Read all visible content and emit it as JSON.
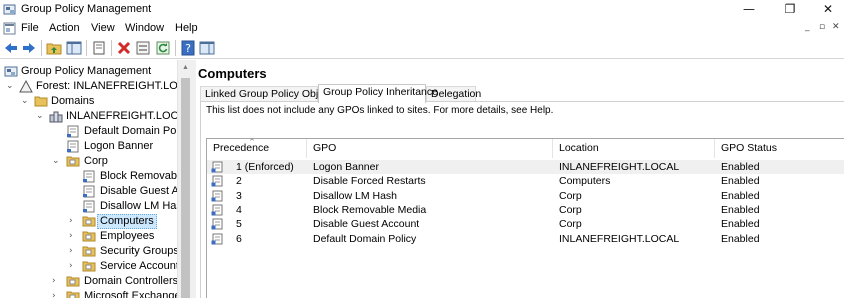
{
  "window": {
    "title": "Group Policy Management",
    "minimize_glyph": "—",
    "restore_glyph": "❐",
    "close_glyph": "✕"
  },
  "menu": {
    "items": [
      "File",
      "Action",
      "View",
      "Window",
      "Help"
    ],
    "mdi": {
      "minimize": "_",
      "restore": "▫",
      "close": "✕"
    }
  },
  "toolbar": {
    "buttons": [
      "back-arrow-icon",
      "forward-arrow-icon",
      "up-folder-icon",
      "show-hide-tree-icon",
      "copy-icon",
      "delete-icon",
      "properties-icon",
      "refresh-icon",
      "help-icon",
      "console-pane-icon"
    ]
  },
  "tree": {
    "nodes": [
      {
        "label": "Group Policy Management",
        "expander": "",
        "icon": "gpm-icon"
      },
      {
        "label": "Forest: INLANEFREIGHT.LOCAL",
        "expander": "⌄",
        "icon": "forest-icon"
      },
      {
        "label": "Domains",
        "expander": "⌄",
        "icon": "folder-icon"
      },
      {
        "label": "INLANEFREIGHT.LOCAL",
        "expander": "⌄",
        "icon": "domain-icon"
      },
      {
        "label": "Default Domain Polic",
        "expander": "",
        "icon": "gpo-link-icon"
      },
      {
        "label": "Logon Banner",
        "expander": "",
        "icon": "gpo-link-icon"
      },
      {
        "label": "Corp",
        "expander": "⌄",
        "icon": "ou-folder-icon"
      },
      {
        "label": "Block Removable",
        "expander": "",
        "icon": "gpo-link-icon"
      },
      {
        "label": "Disable Guest Acc",
        "expander": "",
        "icon": "gpo-link-icon"
      },
      {
        "label": "Disallow LM Hash",
        "expander": "",
        "icon": "gpo-link-icon"
      },
      {
        "label": "Computers",
        "expander": "›",
        "icon": "ou-folder-icon"
      },
      {
        "label": "Employees",
        "expander": "›",
        "icon": "ou-folder-icon"
      },
      {
        "label": "Security Groups",
        "expander": "›",
        "icon": "ou-folder-icon"
      },
      {
        "label": "Service Accounts",
        "expander": "›",
        "icon": "ou-folder-icon"
      },
      {
        "label": "Domain Controllers",
        "expander": "›",
        "icon": "ou-folder-icon"
      },
      {
        "label": "Microsoft Exchange S",
        "expander": "›",
        "icon": "ou-folder-icon"
      }
    ],
    "selected": "Computers"
  },
  "main": {
    "heading": "Computers",
    "tabs": [
      "Linked Group Policy Objects",
      "Group Policy Inheritance",
      "Delegation"
    ],
    "active_tab": "Group Policy Inheritance",
    "note": "This list does not include any GPOs linked to sites. For more details, see Help.",
    "columns": [
      "Precedence",
      "GPO",
      "Location",
      "GPO Status"
    ],
    "sort_glyph": "^",
    "rows": [
      {
        "precedence": "1  (Enforced)",
        "gpo": "Logon Banner",
        "location": "INLANEFREIGHT.LOCAL",
        "status": "Enabled"
      },
      {
        "precedence": "2",
        "gpo": "Disable Forced Restarts",
        "location": "Computers",
        "status": "Enabled"
      },
      {
        "precedence": "3",
        "gpo": "Disallow LM Hash",
        "location": "Corp",
        "status": "Enabled"
      },
      {
        "precedence": "4",
        "gpo": "Block Removable Media",
        "location": "Corp",
        "status": "Enabled"
      },
      {
        "precedence": "5",
        "gpo": "Disable Guest Account",
        "location": "Corp",
        "status": "Enabled"
      },
      {
        "precedence": "6",
        "gpo": "Default Domain Policy",
        "location": "INLANEFREIGHT.LOCAL",
        "status": "Enabled"
      }
    ]
  },
  "colors": {
    "selection": "#cce8ff",
    "folder": "#e8c15a",
    "delete": "#d42a2a",
    "nav_arrow": "#2e6fc7"
  }
}
